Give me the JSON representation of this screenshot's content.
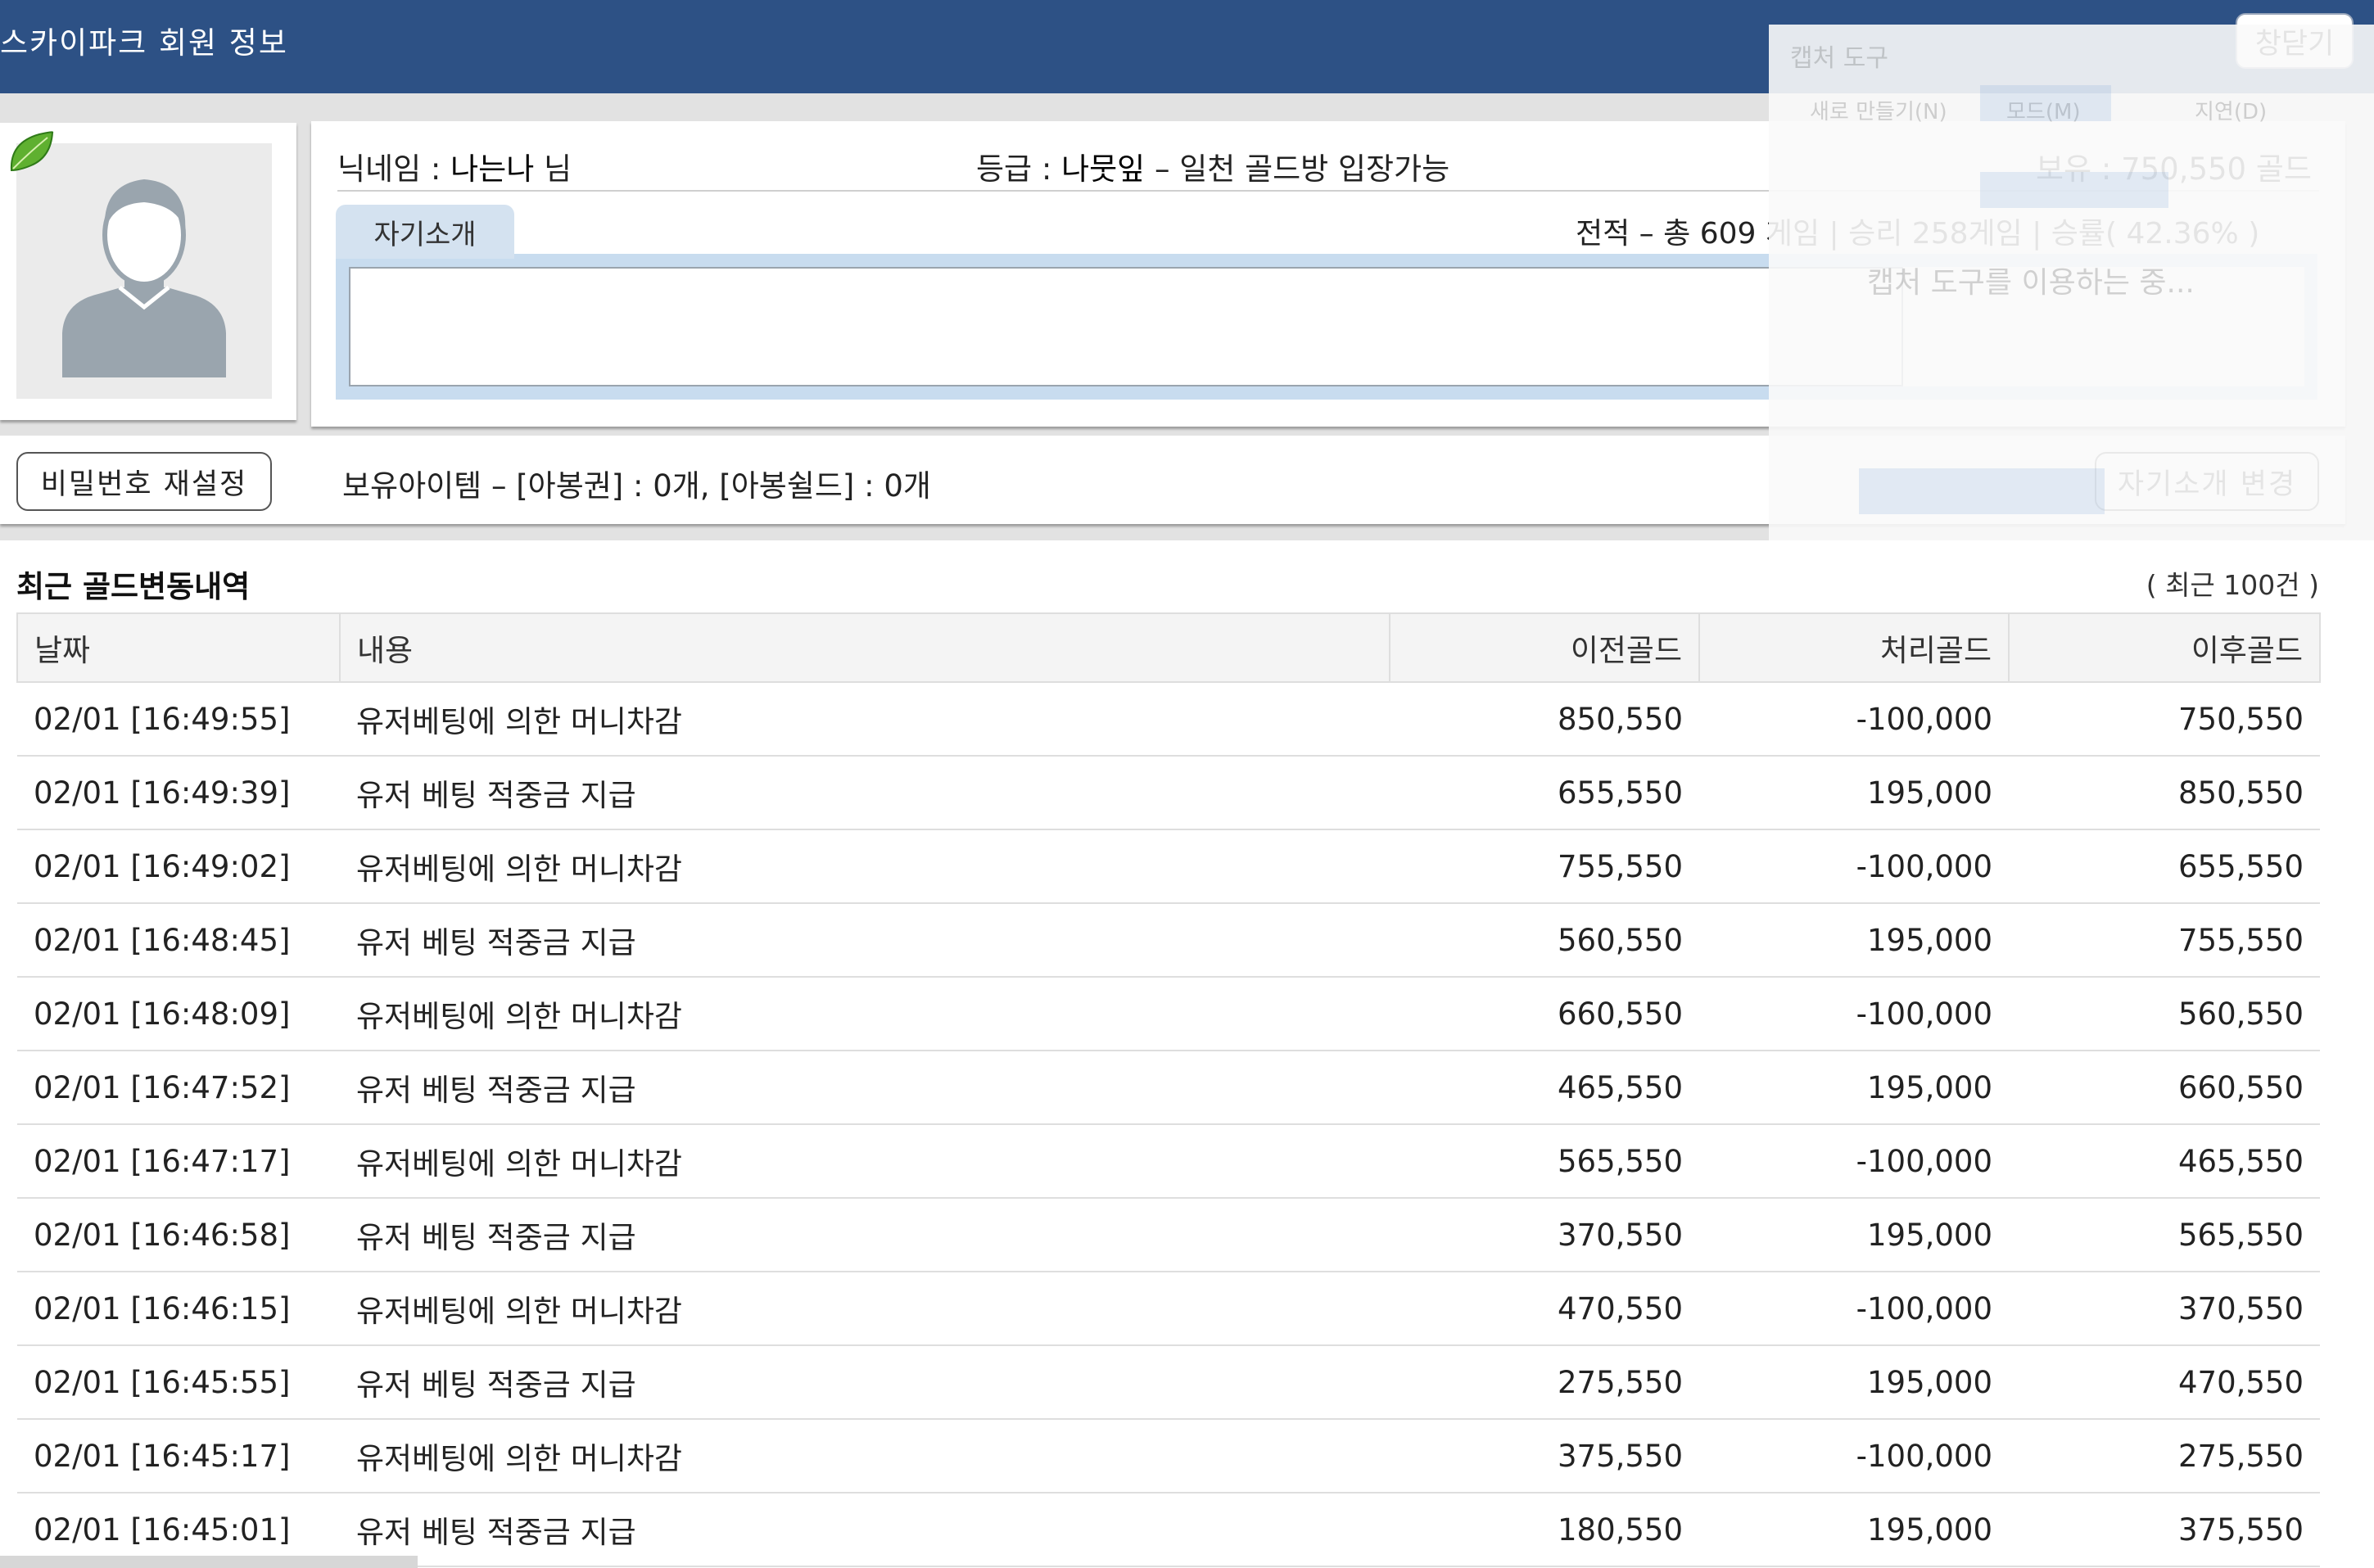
{
  "window": {
    "title": "스카이파크 회원 정보",
    "close_label": "창닫기"
  },
  "profile": {
    "nickname_label": "닉네임 :",
    "nickname": "나는나",
    "nickname_suffix": "님",
    "grade_label": "등급 :",
    "grade": "나뭇잎",
    "grade_desc": "– 일천 골드방 입장가능",
    "holdings": "보유 : 750,550 골드",
    "record": "전적 – 총 609 게임 | 승리 258게임 | 승률( 42.36% )",
    "intro_tab": "자기소개",
    "intro_text": ""
  },
  "actions": {
    "reset_password": "비밀번호 재설정",
    "items": "보유아이템 – [아봉권] : 0개, [아봉쉴드] : 0개",
    "change_intro": "자기소개 변경"
  },
  "history": {
    "title": "최근 골드변동내역",
    "count": "( 최근 100건 )",
    "columns": [
      "날짜",
      "내용",
      "이전골드",
      "처리골드",
      "이후골드"
    ],
    "rows": [
      [
        "02/01 [16:49:55]",
        "유저베팅에 의한 머니차감",
        "850,550",
        "-100,000",
        "750,550"
      ],
      [
        "02/01 [16:49:39]",
        "유저 베팅 적중금 지급",
        "655,550",
        "195,000",
        "850,550"
      ],
      [
        "02/01 [16:49:02]",
        "유저베팅에 의한 머니차감",
        "755,550",
        "-100,000",
        "655,550"
      ],
      [
        "02/01 [16:48:45]",
        "유저 베팅 적중금 지급",
        "560,550",
        "195,000",
        "755,550"
      ],
      [
        "02/01 [16:48:09]",
        "유저베팅에 의한 머니차감",
        "660,550",
        "-100,000",
        "560,550"
      ],
      [
        "02/01 [16:47:52]",
        "유저 베팅 적중금 지급",
        "465,550",
        "195,000",
        "660,550"
      ],
      [
        "02/01 [16:47:17]",
        "유저베팅에 의한 머니차감",
        "565,550",
        "-100,000",
        "465,550"
      ],
      [
        "02/01 [16:46:58]",
        "유저 베팅 적중금 지급",
        "370,550",
        "195,000",
        "565,550"
      ],
      [
        "02/01 [16:46:15]",
        "유저베팅에 의한 머니차감",
        "470,550",
        "-100,000",
        "370,550"
      ],
      [
        "02/01 [16:45:55]",
        "유저 베팅 적중금 지급",
        "275,550",
        "195,000",
        "470,550"
      ],
      [
        "02/01 [16:45:17]",
        "유저베팅에 의한 머니차감",
        "375,550",
        "-100,000",
        "275,550"
      ],
      [
        "02/01 [16:45:01]",
        "유저 베팅 적중금 지급",
        "180,550",
        "195,000",
        "375,550"
      ]
    ]
  },
  "snip_overlay": {
    "app": "캡처 도구",
    "new": "새로 만들기(N)",
    "mode": "모드(M)",
    "delay": "지연(D)",
    "message": "캡처 도구를 이용하는 중..."
  },
  "colors": {
    "header": "#2d5185",
    "intro_frame": "#c8dcef",
    "intro_tab": "#d4e2f0"
  },
  "icons": {
    "leaf": "leaf-icon",
    "avatar": "user-silhouette-icon"
  }
}
